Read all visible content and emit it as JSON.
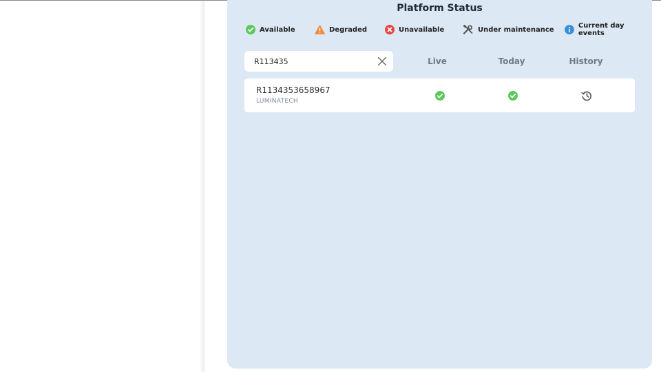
{
  "panel": {
    "title": "Platform Status"
  },
  "legend": {
    "available": {
      "label": "Available",
      "icon": "check-circle-icon",
      "color": "#5bc95b"
    },
    "degraded": {
      "label": "Degraded",
      "icon": "warning-triangle-icon",
      "color": "#f08a3c"
    },
    "unavailable": {
      "label": "Unavailable",
      "icon": "x-circle-icon",
      "color": "#e64545"
    },
    "maintenance": {
      "label": "Under maintenance",
      "icon": "tools-icon",
      "color": "#555555"
    },
    "events": {
      "label": "Current day events",
      "icon": "info-circle-icon",
      "color": "#3a8fd6"
    }
  },
  "search": {
    "value": "R113435",
    "clear_icon": "close-icon"
  },
  "columns": {
    "live": "Live",
    "today": "Today",
    "history": "History"
  },
  "results": [
    {
      "id": "R1134353658967",
      "company": "LUMINATECH",
      "live": "available",
      "today": "available",
      "history_icon": "history-icon"
    }
  ]
}
